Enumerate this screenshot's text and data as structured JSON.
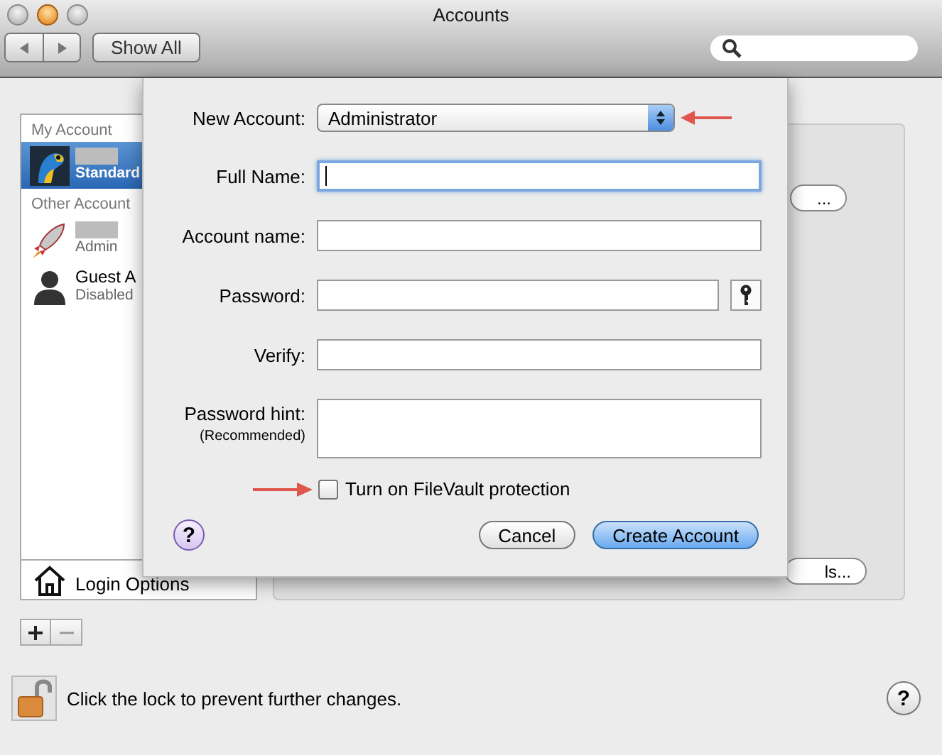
{
  "window": {
    "title": "Accounts"
  },
  "toolbar": {
    "show_all": "Show All"
  },
  "sidebar": {
    "sections": [
      {
        "header": "My Account",
        "items": [
          {
            "role": "Standard",
            "selected": true
          }
        ]
      },
      {
        "header": "Other Account",
        "items": [
          {
            "role": "Admin",
            "selected": false
          },
          {
            "name": "Guest A",
            "role": "Disabled",
            "selected": false
          }
        ]
      }
    ],
    "login_options": "Login Options"
  },
  "panel": {
    "buttons": [
      "...",
      "ls..."
    ]
  },
  "sheet": {
    "new_account": {
      "label": "New Account:",
      "value": "Administrator"
    },
    "fields": [
      {
        "kind": "text",
        "label": "Full Name:",
        "focused": true
      },
      {
        "kind": "text",
        "label": "Account name:",
        "focused": false
      },
      {
        "kind": "password",
        "label": "Password:",
        "focused": false
      },
      {
        "kind": "text",
        "label": "Verify:",
        "focused": false
      },
      {
        "kind": "hint",
        "label": "Password hint:",
        "sublabel": "(Recommended)",
        "focused": false
      }
    ],
    "filevault": {
      "label": "Turn on FileVault protection",
      "checked": false
    },
    "help": "?",
    "buttons": [
      {
        "label": "Cancel",
        "default": false
      },
      {
        "label": "Create Account",
        "default": true
      }
    ]
  },
  "footer": {
    "lock_text": "Click the lock to prevent further changes.",
    "help": "?"
  }
}
